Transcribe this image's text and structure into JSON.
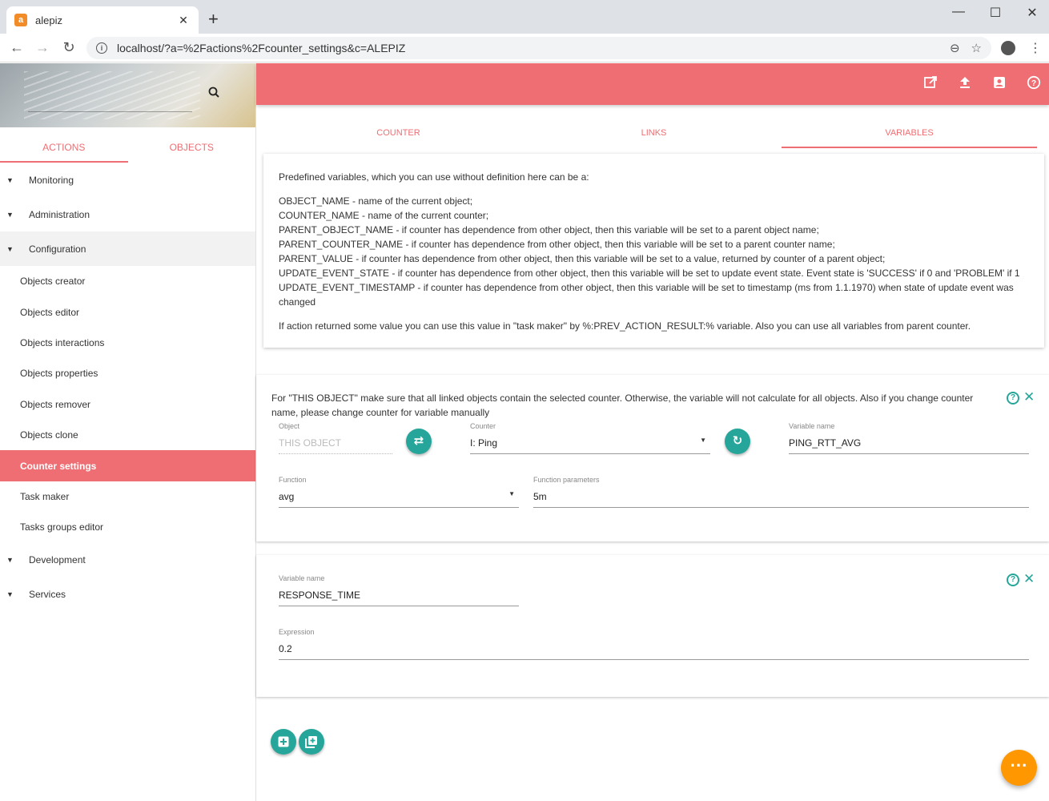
{
  "browser": {
    "tab_title": "alepiz",
    "favicon_letter": "a",
    "url": "localhost/?a=%2Factions%2Fcounter_settings&c=ALEPIZ"
  },
  "sidebar": {
    "tabs": [
      {
        "label": "ACTIONS"
      },
      {
        "label": "OBJECTS"
      }
    ],
    "groups_top": [
      {
        "label": "Monitoring"
      },
      {
        "label": "Administration"
      },
      {
        "label": "Configuration"
      }
    ],
    "items": [
      {
        "label": "Objects creator"
      },
      {
        "label": "Objects editor"
      },
      {
        "label": "Objects interactions"
      },
      {
        "label": "Objects properties"
      },
      {
        "label": "Objects remover"
      },
      {
        "label": "Objects clone"
      },
      {
        "label": "Counter settings"
      },
      {
        "label": "Task maker"
      },
      {
        "label": "Tasks groups editor"
      }
    ],
    "groups_bottom": [
      {
        "label": "Development"
      },
      {
        "label": "Services"
      }
    ]
  },
  "main_tabs": [
    {
      "label": "COUNTER"
    },
    {
      "label": "LINKS"
    },
    {
      "label": "VARIABLES"
    }
  ],
  "info_card": {
    "intro": "Predefined variables, which you can use without definition here can be a:",
    "vars": [
      "OBJECT_NAME - name of the current object;",
      "COUNTER_NAME - name of the current counter;",
      "PARENT_OBJECT_NAME - if counter has dependence from other object, then this variable will be set to a parent object name;",
      "PARENT_COUNTER_NAME - if counter has dependence from other object, then this variable will be set to a parent counter name;",
      "PARENT_VALUE - if counter has dependence from other object, then this variable will be set to a value, returned by counter of a parent object;",
      "UPDATE_EVENT_STATE - if counter has dependence from other object, then this variable will be set to update event state. Event state is 'SUCCESS' if 0 and 'PROBLEM' if 1",
      "UPDATE_EVENT_TIMESTAMP - if counter has dependence from other object, then this variable will be set to timestamp (ms from 1.1.1970) when state of update event was changed"
    ],
    "footer": "If action returned some value you can use this value in \"task maker\" by %:PREV_ACTION_RESULT:% variable. Also you can use all variables from parent counter."
  },
  "variable1": {
    "note": "For \"THIS OBJECT\" make sure that all linked objects contain the selected counter. Otherwise, the variable will not calculate for all objects. Also if you change counter name, please change counter for variable manually",
    "object_label": "Object",
    "object_value": "THIS OBJECT",
    "counter_label": "Counter",
    "counter_value": "I: Ping",
    "varname_label": "Variable name",
    "varname_value": "PING_RTT_AVG",
    "function_label": "Function",
    "function_value": "avg",
    "params_label": "Function parameters",
    "params_value": "5m"
  },
  "variable2": {
    "varname_label": "Variable name",
    "varname_value": "RESPONSE_TIME",
    "expression_label": "Expression",
    "expression_value": "0.2"
  },
  "colors": {
    "accent": "#ef6e73",
    "teal": "#26a69a",
    "fab": "#ff9800"
  },
  "icons": {
    "help": "?",
    "close": "✕",
    "fab": "···"
  }
}
